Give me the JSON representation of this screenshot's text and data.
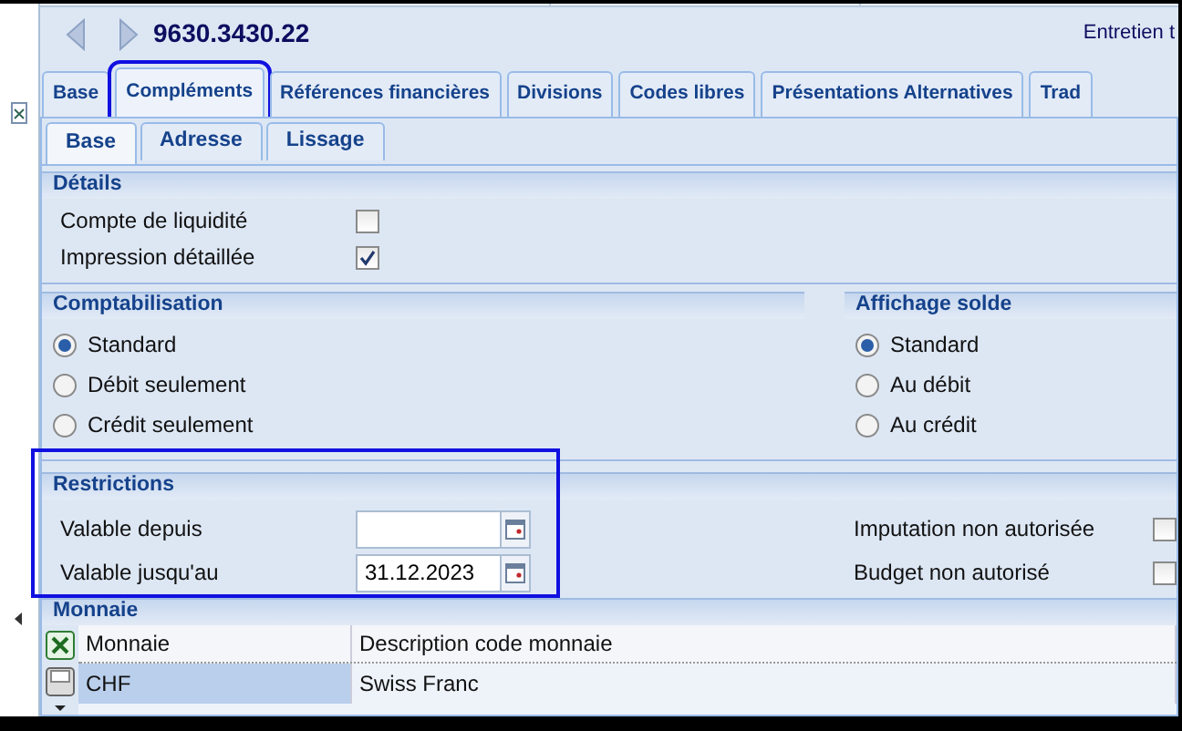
{
  "header": {
    "title": "9630.3430.22",
    "right_text": "Entretien t"
  },
  "tabs": [
    {
      "label": "Base",
      "selected": false,
      "highlighted": false
    },
    {
      "label": "Compléments",
      "selected": true,
      "highlighted": true
    },
    {
      "label": "Références financières",
      "selected": false,
      "highlighted": false
    },
    {
      "label": "Divisions",
      "selected": false,
      "highlighted": false
    },
    {
      "label": "Codes libres",
      "selected": false,
      "highlighted": false
    },
    {
      "label": "Présentations Alternatives",
      "selected": false,
      "highlighted": false
    },
    {
      "label": "Trad",
      "selected": false,
      "highlighted": false
    }
  ],
  "subtabs": [
    {
      "label": "Base",
      "selected": true
    },
    {
      "label": "Adresse",
      "selected": false
    },
    {
      "label": "Lissage",
      "selected": false
    }
  ],
  "details": {
    "title": "Détails",
    "fields": [
      {
        "label": "Compte de liquidité",
        "checked": false
      },
      {
        "label": "Impression détaillée",
        "checked": true
      }
    ]
  },
  "comptabilisation": {
    "title": "Comptabilisation",
    "options": [
      {
        "label": "Standard",
        "selected": true
      },
      {
        "label": "Débit seulement",
        "selected": false
      },
      {
        "label": "Crédit seulement",
        "selected": false
      }
    ]
  },
  "affichage_solde": {
    "title": "Affichage solde",
    "options": [
      {
        "label": "Standard",
        "selected": true
      },
      {
        "label": "Au débit",
        "selected": false
      },
      {
        "label": "Au crédit",
        "selected": false
      }
    ]
  },
  "restrictions": {
    "title": "Restrictions",
    "highlighted": true,
    "fields": [
      {
        "label": "Valable depuis"
      },
      {
        "label": "Valable jusqu'au",
        "value": "31.12.2023"
      }
    ],
    "flags": [
      {
        "label": "Imputation non autorisée",
        "checked": false
      },
      {
        "label": "Budget non autorisé",
        "checked": false
      }
    ]
  },
  "monnaie": {
    "title": "Monnaie",
    "columns": [
      "Monnaie",
      "Description code monnaie"
    ],
    "rows": [
      {
        "cells": [
          "CHF",
          "Swiss Franc"
        ],
        "selected": true
      }
    ]
  }
}
